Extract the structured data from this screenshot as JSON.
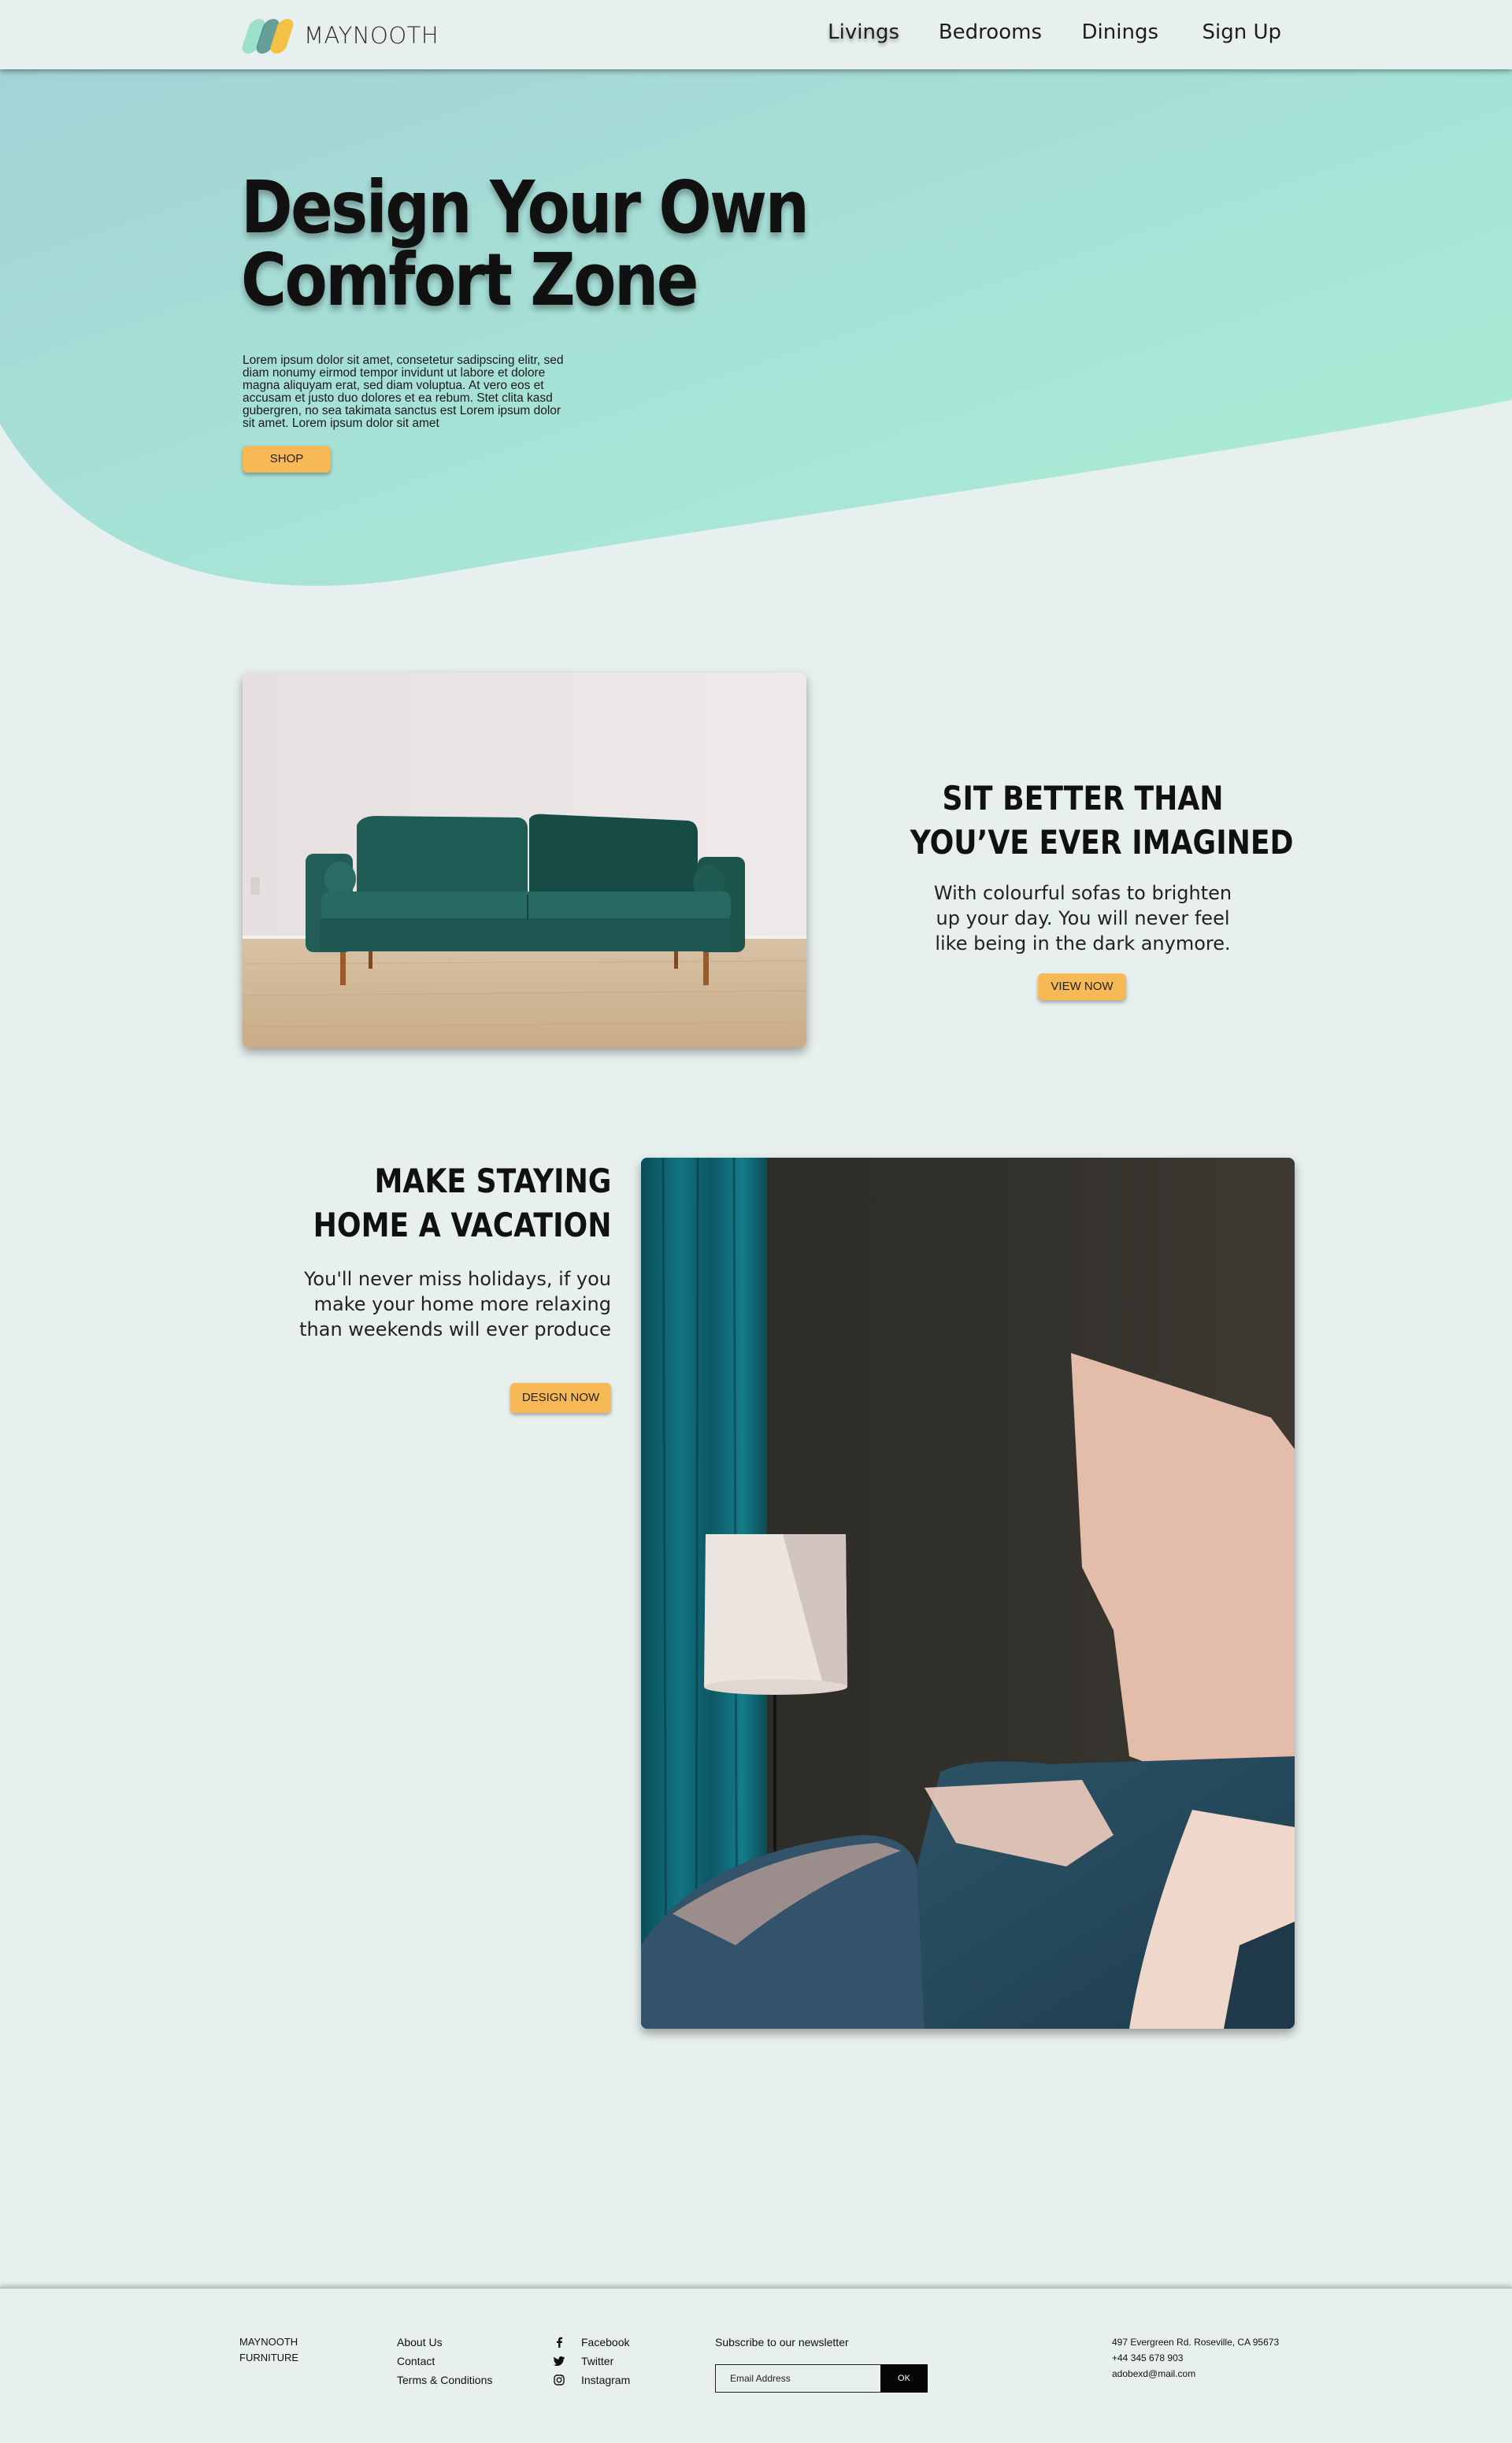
{
  "brand": {
    "name": "MAYNOOTH"
  },
  "nav": {
    "items": [
      {
        "label": "Livings"
      },
      {
        "label": "Bedrooms"
      },
      {
        "label": "Dinings"
      },
      {
        "label": "Sign Up"
      }
    ]
  },
  "hero": {
    "title_line1": "Design Your Own",
    "title_line2": "Comfort Zone",
    "body": "Lorem ipsum dolor sit amet, consetetur sadipscing elitr, sed diam nonumy eirmod tempor invidunt ut labore et dolore magna aliquyam erat, sed diam voluptua. At vero eos et accusam et justo duo dolores et ea rebum. Stet clita kasd gubergren, no sea takimata sanctus est Lorem ipsum dolor sit amet. Lorem ipsum dolor sit amet",
    "button": "SHOP"
  },
  "sofa_section": {
    "title_line1": "SIT BETTER THAN",
    "title_line2": "YOU’VE EVER IMAGINED",
    "body": "With colourful sofas to brighten up your day. You will never feel like being in the dark anymore.",
    "button": "VIEW NOW"
  },
  "vacation_section": {
    "title_line1": "MAKE STAYING",
    "title_line2": "HOME A VACATION",
    "body": "You'll never miss holidays, if you make your home more relaxing than weekends will ever produce",
    "button": "DESIGN NOW"
  },
  "footer": {
    "brand_line1": "MAYNOOTH",
    "brand_line2": "FURNITURE",
    "links": [
      "About Us",
      "Contact",
      "Terms & Conditions"
    ],
    "social": [
      {
        "label": "Facebook",
        "icon": "facebook-icon"
      },
      {
        "label": "Twitter",
        "icon": "twitter-icon"
      },
      {
        "label": "Instagram",
        "icon": "instagram-icon"
      }
    ],
    "newsletter": {
      "label": "Subscribe to our newsletter",
      "placeholder": "Email Address",
      "button": "OK"
    },
    "contact": {
      "address": "497 Evergreen Rd. Roseville, CA 95673",
      "phone": "+44 345 678 903",
      "email": "adobexd@mail.com"
    }
  },
  "colors": {
    "background": "#e7f0ee",
    "hero_teal_start": "#a3d6d6",
    "hero_teal_end": "#a9ead6",
    "accent_button": "#f6b955",
    "logo_yellow": "#f4c142"
  }
}
